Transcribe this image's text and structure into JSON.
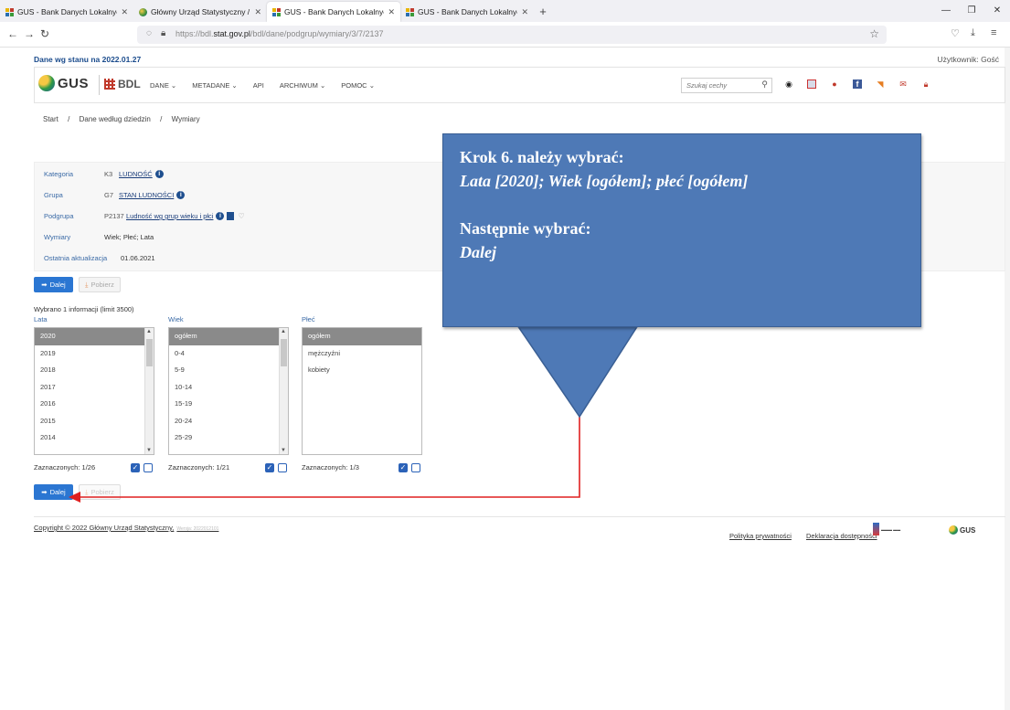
{
  "browser": {
    "tabs": [
      {
        "title": "GUS - Bank Danych Lokalnych",
        "active": false,
        "favicon": "gus-grid"
      },
      {
        "title": "Główny Urząd Statystyczny / Po",
        "active": false,
        "favicon": "gus-ball"
      },
      {
        "title": "GUS - Bank Danych Lokalnych",
        "active": true,
        "favicon": "gus-grid"
      },
      {
        "title": "GUS - Bank Danych Lokalnych",
        "active": false,
        "favicon": "gus-grid"
      }
    ],
    "url_prefix": "https://bdl.",
    "url_domain": "stat.gov.pl",
    "url_path": "/bdl/dane/podgrup/wymiary/3/7/2137"
  },
  "page": {
    "as_of": "Dane wg stanu na 2022.01.27",
    "user": "Użytkownik: Gość",
    "logo_gus": "GUS",
    "logo_bdl": "BDL",
    "nav": [
      "DANE",
      "METADANE",
      "API",
      "ARCHIWUM",
      "POMOC"
    ],
    "search_placeholder": "Szukaj cechy",
    "breadcrumb": [
      "Start",
      "/",
      "Dane według dziedzin",
      "/",
      "Wymiary"
    ],
    "info": {
      "kategoria_label": "Kategoria",
      "kategoria_code": "K3",
      "kategoria_value": "LUDNOŚĆ",
      "grupa_label": "Grupa",
      "grupa_code": "G7",
      "grupa_value": "STAN LUDNOŚCI",
      "podgrupa_label": "Podgrupa",
      "podgrupa_code": "P2137",
      "podgrupa_value": "Ludność wg grup wieku i płci",
      "wymiary_label": "Wymiary",
      "wymiary_value": "Wiek; Płeć; Lata",
      "aktualizacja_label": "Ostatnia aktualizacja",
      "aktualizacja_value": "01.06.2021"
    },
    "btn_dalej": "Dalej",
    "btn_pobierz": "Pobierz",
    "selected_info": "Wybrano 1 informacji (limit 3500)",
    "columns": [
      {
        "header": "Lata",
        "items": [
          "2020",
          "2019",
          "2018",
          "2017",
          "2016",
          "2015",
          "2014"
        ],
        "selected": 0,
        "counter": "Zaznaczonych: 1/26"
      },
      {
        "header": "Wiek",
        "items": [
          "ogółem",
          "0-4",
          "5-9",
          "10-14",
          "15-19",
          "20-24",
          "25-29"
        ],
        "selected": 0,
        "counter": "Zaznaczonych: 1/21"
      },
      {
        "header": "Płeć",
        "items": [
          "ogółem",
          "mężczyźni",
          "kobiety"
        ],
        "selected": 0,
        "counter": "Zaznaczonych: 1/3"
      }
    ],
    "footer": {
      "copyright": "Copyright © 2022 Główny Urząd Statystyczny,",
      "version": "Wersja: 2022012101",
      "privacy": "Polityka prywatności",
      "accessibility": "Deklaracja dostępności",
      "gus": "GUS"
    }
  },
  "callout": {
    "line1": "Krok 6. należy wybrać:",
    "line2": "Lata [2020]; Wiek [ogółem]; płeć [ogółem]",
    "line3": "Następnie wybrać:",
    "line4": "Dalej",
    "fill": "#4e79b6",
    "arrow_color": "#e02020"
  }
}
